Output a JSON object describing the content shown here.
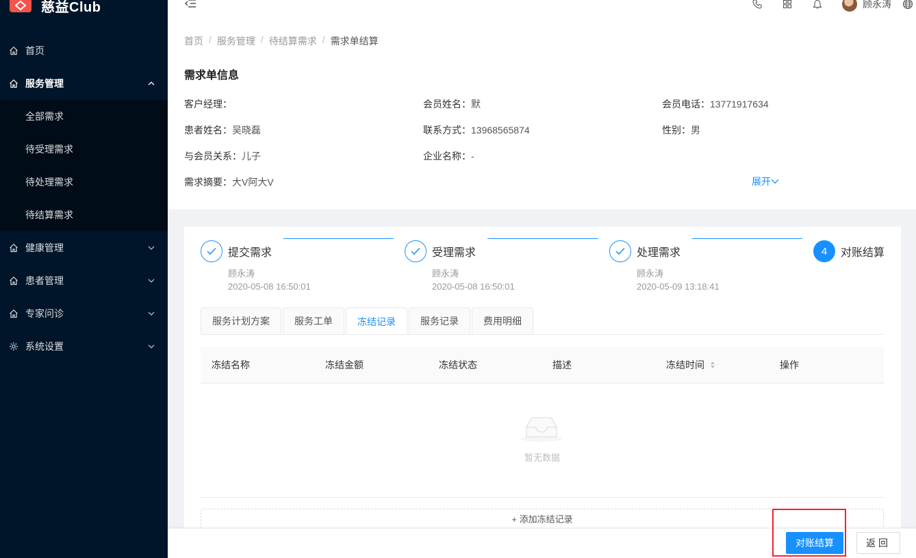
{
  "app": {
    "logo_text": "慈益Club"
  },
  "sidebar": {
    "items": [
      {
        "label": "首页",
        "icon": "home-icon"
      },
      {
        "label": "服务管理",
        "icon": "home-icon",
        "open": true
      },
      {
        "label": "健康管理",
        "icon": "home-icon"
      },
      {
        "label": "患者管理",
        "icon": "home-icon"
      },
      {
        "label": "专家问诊",
        "icon": "home-icon"
      },
      {
        "label": "系统设置",
        "icon": "gear-icon"
      }
    ],
    "subitems": [
      "全部需求",
      "待受理需求",
      "待处理需求",
      "待结算需求"
    ]
  },
  "header": {
    "user_name": "顾永涛"
  },
  "breadcrumb": [
    "首页",
    "服务管理",
    "待结算需求",
    "需求单结算"
  ],
  "info": {
    "title": "需求单信息",
    "fields": [
      {
        "label": "客户经理：",
        "value": ""
      },
      {
        "label": "会员姓名：",
        "value": "默"
      },
      {
        "label": "会员电话：",
        "value": "13771917634"
      },
      {
        "label": "患者姓名：",
        "value": "吴晓磊"
      },
      {
        "label": "联系方式：",
        "value": "13968565874"
      },
      {
        "label": "性别：",
        "value": "男"
      },
      {
        "label": "与会员关系：",
        "value": "儿子"
      },
      {
        "label": "企业名称：",
        "value": "-"
      },
      {
        "label": "需求摘要：",
        "value": "大V阿大V"
      }
    ],
    "expand_label": "展开"
  },
  "steps": [
    {
      "title": "提交需求",
      "person": "顾永涛",
      "time": "2020-05-08 16:50:01",
      "status": "done"
    },
    {
      "title": "受理需求",
      "person": "顾永涛",
      "time": "2020-05-08 16:50:01",
      "status": "done"
    },
    {
      "title": "处理需求",
      "person": "顾永涛",
      "time": "2020-05-09 13:18:41",
      "status": "done"
    },
    {
      "title": "对账结算",
      "number": "4",
      "status": "active"
    }
  ],
  "tabs": [
    "服务计划方案",
    "服务工单",
    "冻结记录",
    "服务记录",
    "费用明细"
  ],
  "active_tab": "冻结记录",
  "table": {
    "columns": [
      "冻结名称",
      "冻结金额",
      "冻结状态",
      "描述",
      "冻结时间",
      "操作"
    ],
    "empty_text": "暂无数据"
  },
  "add_record_label": "+ 添加冻结记录",
  "footer": {
    "settle_label": "对账结算",
    "back_label": "返回"
  },
  "colors": {
    "sidebar_bg": "#001529",
    "primary": "#1890ff",
    "highlight": "#f5222d",
    "logo": "#f5544b"
  }
}
